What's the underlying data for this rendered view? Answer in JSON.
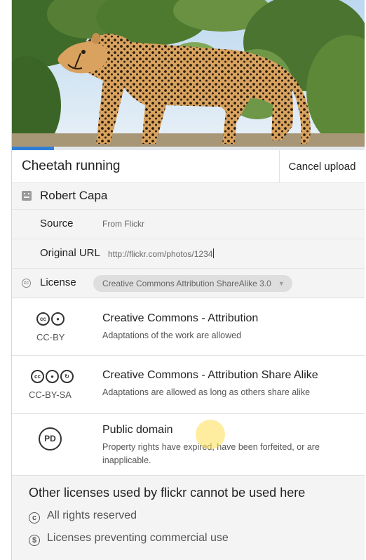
{
  "photo": {
    "subject": "cheetah",
    "upload_progress": 0.12
  },
  "title": {
    "value": "Cheetah running",
    "cancel_label": "Cancel upload"
  },
  "author": {
    "name": "Robert Capa"
  },
  "source": {
    "label": "Source",
    "value": "From Flickr"
  },
  "original_url": {
    "label": "Original URL",
    "value": "http://flickr.com/photos/1234"
  },
  "license": {
    "label": "License",
    "selected": "Creative Commons Attribution ShareAlike 3.0"
  },
  "license_options": [
    {
      "code": "CC-BY",
      "title": "Creative Commons - Attribution",
      "description": "Adaptations of the work are allowed"
    },
    {
      "code": "CC-BY-SA",
      "title": "Creative Commons - Attribution Share Alike",
      "description": "Adaptations are allowed as long as others share alike"
    },
    {
      "code": "PD",
      "title": "Public domain",
      "description": "Property rights have expired, have been forfeited, or are inapplicable."
    }
  ],
  "other_licenses": {
    "heading": "Other licenses used by flickr cannot be used here",
    "items": [
      {
        "icon": "copyright-icon",
        "label": "All rights reserved"
      },
      {
        "icon": "noncommercial-icon",
        "label": "Licenses preventing commercial use"
      }
    ]
  },
  "colors": {
    "accent": "#2f7fd6",
    "pill": "#dedede",
    "panel": "#f4f4f4"
  }
}
